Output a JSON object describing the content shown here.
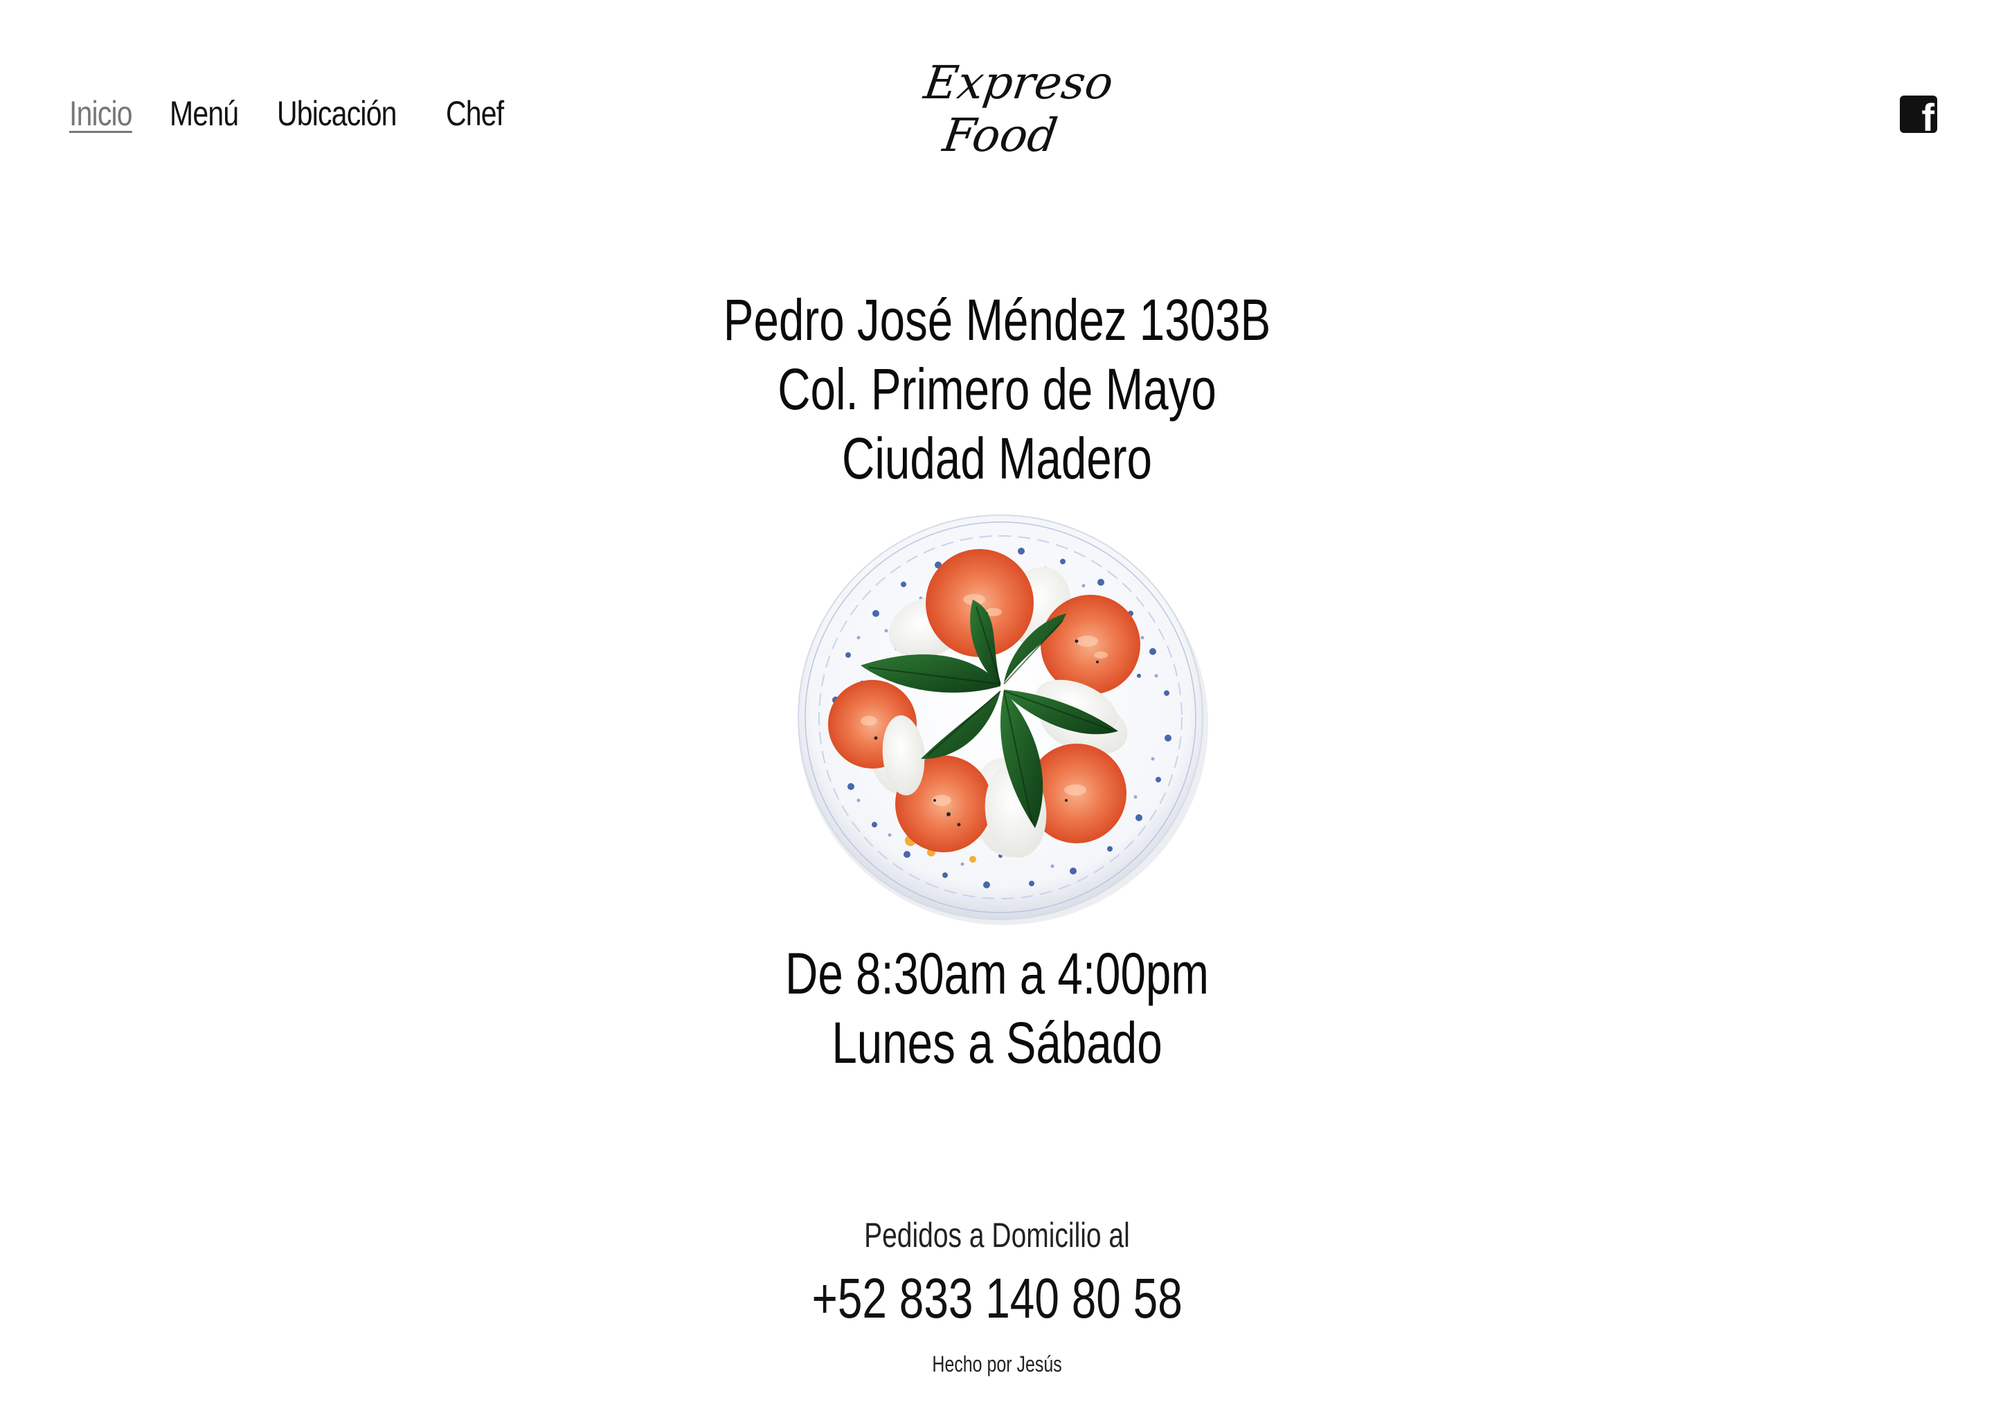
{
  "nav": {
    "items": [
      {
        "label": "Inicio",
        "active": true
      },
      {
        "label": "Menú",
        "active": false
      },
      {
        "label": "Ubicación",
        "active": false
      },
      {
        "label": "Chef",
        "active": false
      }
    ]
  },
  "logo": {
    "line1": "Expreso",
    "line2": "Food"
  },
  "social": {
    "icon": "facebook-icon"
  },
  "address": {
    "line1": "Pedro José Méndez 1303B",
    "line2": "Col. Primero de Mayo",
    "line3": "Ciudad Madero"
  },
  "image": {
    "subject": "caprese-salad-plate"
  },
  "hours": {
    "line1": "De 8:30am a 4:00pm",
    "line2": "Lunes a Sábado"
  },
  "delivery": {
    "label": "Pedidos a Domicilio al",
    "phone": "+52 833 140 80 58"
  },
  "footer": {
    "credit": "Hecho por Jesús"
  },
  "colors": {
    "background": "#ffffff",
    "text": "#0b0b0b",
    "active_nav": "#777777"
  }
}
